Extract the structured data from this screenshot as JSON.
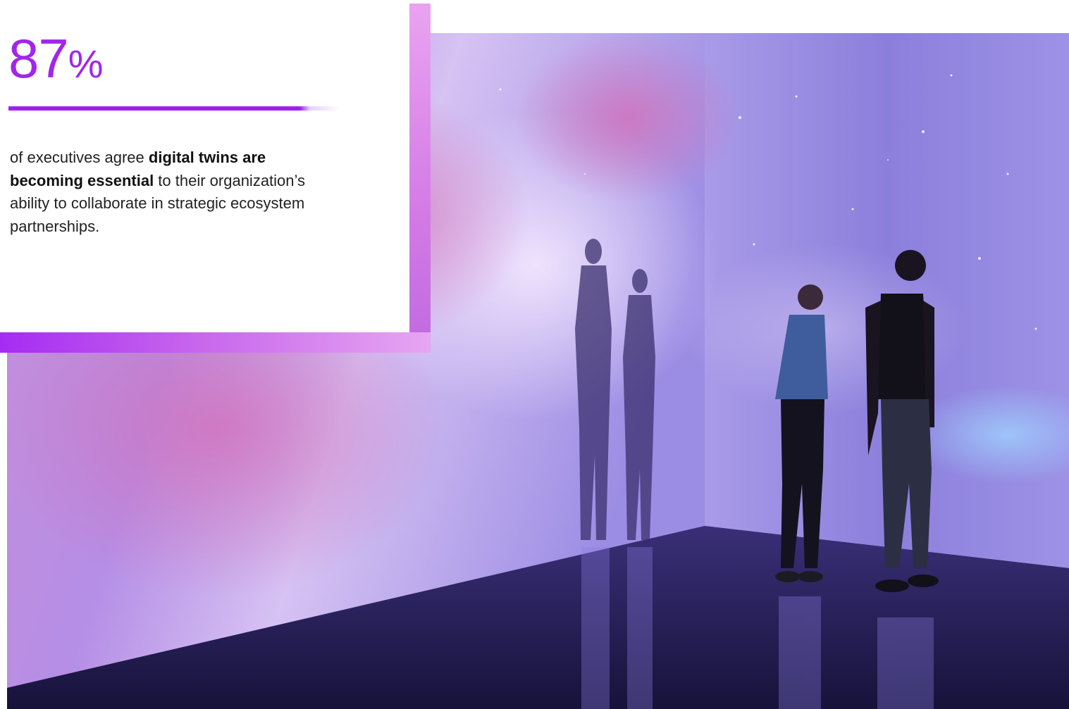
{
  "stat": {
    "number": "87",
    "unit": "%",
    "text_before": "of executives agree ",
    "text_bold": "digital twins are becoming essential",
    "text_after": " to their organization’s ability to collaborate in strategic ecosystem partnerships."
  },
  "colors": {
    "accent": "#a126ea",
    "accent_light": "#e6a6f2",
    "text": "#222222",
    "projection_wall": "#b69be8",
    "floor": "#231c4d"
  },
  "photo": {
    "subject": "two people looking at a projected galaxy on gallery walls"
  }
}
